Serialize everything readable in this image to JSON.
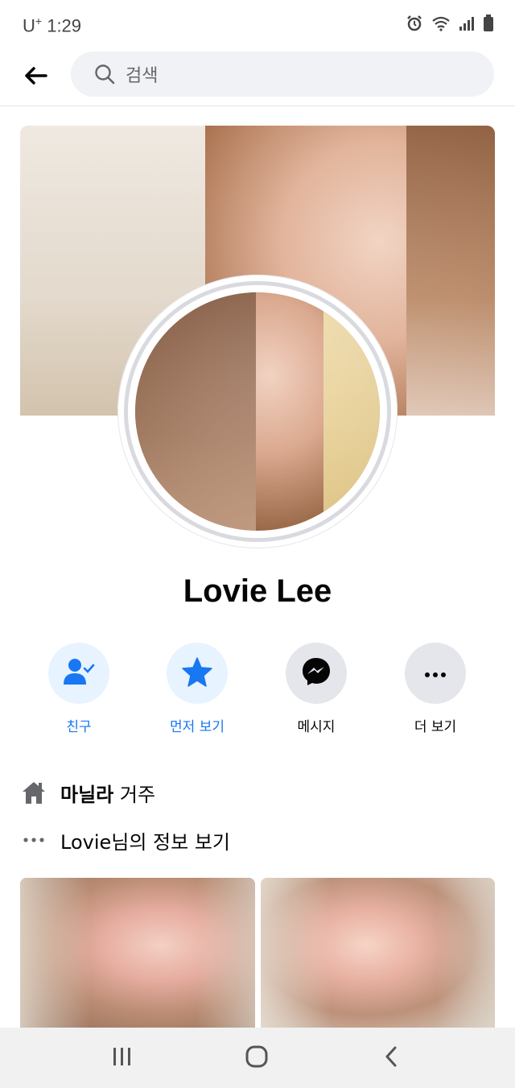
{
  "status_bar": {
    "carrier": "U",
    "carrier_sup": "+",
    "time": "1:29",
    "icons": [
      "alarm-icon",
      "wifi-icon",
      "signal-icon",
      "battery-icon"
    ]
  },
  "header": {
    "back_icon": "arrow-left-icon",
    "search_placeholder": "검색"
  },
  "profile": {
    "name": "Lovie Lee"
  },
  "actions": [
    {
      "label": "친구",
      "icon": "friend-check-icon",
      "style": "blue"
    },
    {
      "label": "먼저 보기",
      "icon": "star-icon",
      "style": "blue"
    },
    {
      "label": "메시지",
      "icon": "messenger-icon",
      "style": "dark"
    },
    {
      "label": "더 보기",
      "icon": "more-icon",
      "style": "dark"
    }
  ],
  "info": {
    "lives_in_bold": "마닐라",
    "lives_in_suffix": " 거주",
    "see_info": "Lovie님의 정보 보기"
  },
  "colors": {
    "accent": "#1877f2",
    "accent_bg": "#e7f3ff",
    "gray_bg": "#e4e6eb",
    "search_bg": "#f0f2f5"
  },
  "navbar": {
    "icons": [
      "recent-apps-icon",
      "home-icon",
      "back-icon"
    ]
  }
}
